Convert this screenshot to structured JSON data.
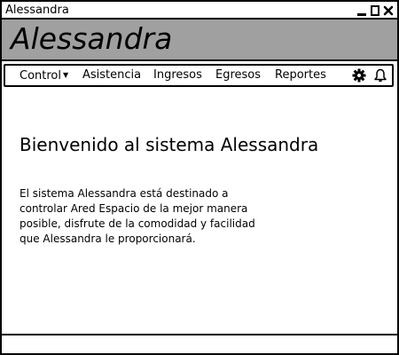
{
  "window": {
    "title": "Alessandra",
    "controls": [
      "minimize-icon",
      "maximize-icon",
      "close-icon"
    ]
  },
  "banner": {
    "app_name": "Alessandra",
    "background": "#a0a0a0"
  },
  "nav": {
    "items": [
      {
        "label": "Control",
        "has_dropdown": true
      },
      {
        "label": "Asistencia"
      },
      {
        "label": "Ingresos"
      },
      {
        "label": "Egresos"
      },
      {
        "label": "Reportes"
      }
    ],
    "icons": [
      "gear-icon",
      "bell-icon"
    ]
  },
  "main": {
    "welcome_title": "Bienvenido al sistema Alessandra",
    "description": "El sistema Alessandra está destinado a controlar Ared Espacio de la mejor manera posible, disfrute de la comodidad y facilidad que Alessandra le proporcionará."
  }
}
